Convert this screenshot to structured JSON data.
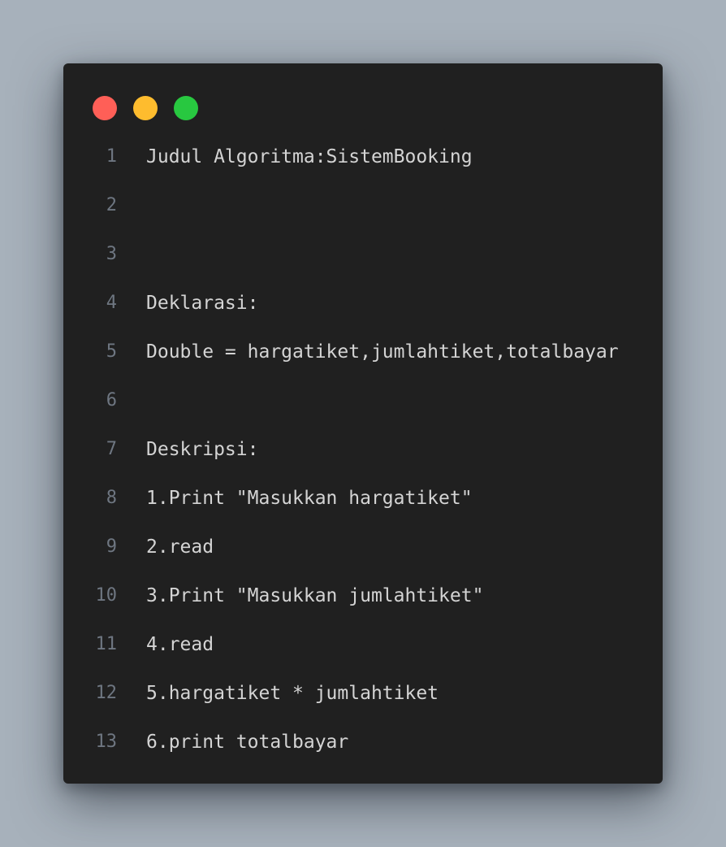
{
  "window": {
    "controls": [
      {
        "name": "close",
        "color": "#ff5f57"
      },
      {
        "name": "minimize",
        "color": "#febc2e"
      },
      {
        "name": "maximize",
        "color": "#28c840"
      }
    ]
  },
  "editor": {
    "lines": [
      {
        "number": "1",
        "text": "Judul Algoritma:SistemBooking"
      },
      {
        "number": "2",
        "text": ""
      },
      {
        "number": "3",
        "text": ""
      },
      {
        "number": "4",
        "text": "Deklarasi:"
      },
      {
        "number": "5",
        "text": "Double = hargatiket,jumlahtiket,totalbayar"
      },
      {
        "number": "6",
        "text": ""
      },
      {
        "number": "7",
        "text": "Deskripsi:"
      },
      {
        "number": "8",
        "text": "1.Print \"Masukkan hargatiket\""
      },
      {
        "number": "9",
        "text": "2.read"
      },
      {
        "number": "10",
        "text": "3.Print \"Masukkan jumlahtiket\""
      },
      {
        "number": "11",
        "text": "4.read"
      },
      {
        "number": "12",
        "text": "5.hargatiket * jumlahtiket"
      },
      {
        "number": "13",
        "text": "6.print totalbayar"
      }
    ]
  }
}
